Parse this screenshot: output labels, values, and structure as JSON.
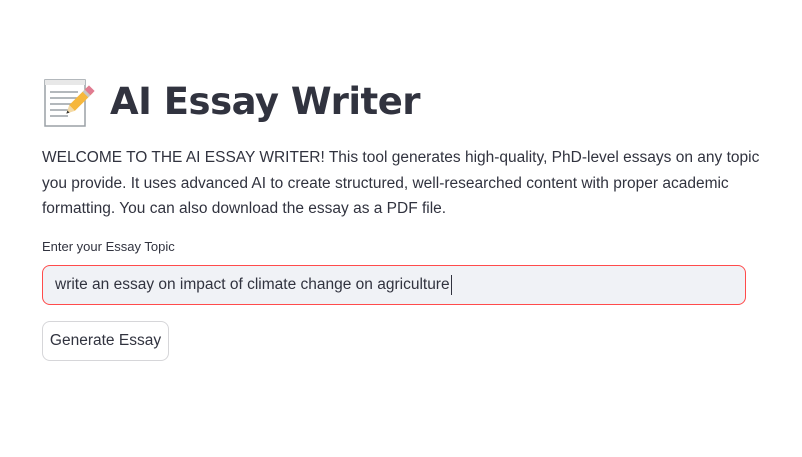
{
  "header": {
    "title": "AI Essay Writer",
    "icon": "memo-pencil-icon"
  },
  "intro": {
    "text": "WELCOME TO THE AI ESSAY WRITER! This tool generates high-quality, PhD-level essays on any topic you provide. It uses advanced AI to create structured, well-researched content with proper academic formatting. You can also download the essay as a PDF file."
  },
  "topic_input": {
    "label": "Enter your Essay Topic",
    "value": "write an essay on impact of climate change on agriculture"
  },
  "actions": {
    "generate_label": "Generate Essay"
  },
  "colors": {
    "accent": "#ff4b4b",
    "input_bg": "#f0f2f6",
    "text": "#31333f"
  }
}
